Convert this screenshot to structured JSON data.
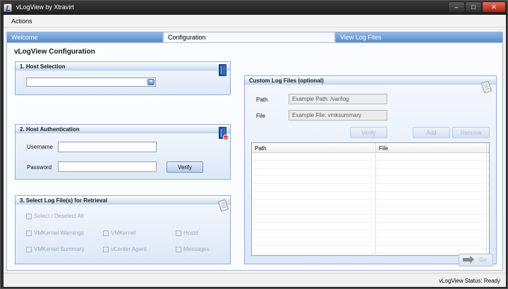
{
  "window": {
    "title": "vLogView by Xtravirt",
    "minimize": "–",
    "maximize": "□",
    "close": "✕"
  },
  "menu": {
    "items": [
      "Actions"
    ]
  },
  "tabs": [
    {
      "label": "Welcome",
      "active": false
    },
    {
      "label": "Configuration",
      "active": true
    },
    {
      "label": "View Log Files",
      "active": false
    }
  ],
  "page": {
    "title": "vLogView Configuration"
  },
  "host_selection": {
    "title": "1. Host Selection",
    "selected": "",
    "arrow": "▾"
  },
  "host_auth": {
    "title": "2. Host Authentication",
    "username_label": "Username",
    "username_value": "",
    "password_label": "Password",
    "password_value": "",
    "verify_label": "Verify"
  },
  "log_select": {
    "title": "3. Select Log File(s) for Retrieval",
    "select_all": "Select / Deselect All",
    "options": [
      "VMKernel Warnings",
      "VMKernel",
      "Hostd",
      "VMKernel Summary",
      "vCenter Agent",
      "Messages"
    ]
  },
  "custom_logs": {
    "title": "Custom Log Files (optional)",
    "path_label": "Path",
    "path_placeholder": "Example Path:  /var/log",
    "file_label": "File",
    "file_placeholder": "Example File:  vmksummary",
    "verify_label": "Verify",
    "add_label": "Add",
    "remove_label": "Remove",
    "columns": [
      "Path",
      "File"
    ]
  },
  "go": {
    "label": "Go"
  },
  "status": {
    "text": "vLogView Status: Ready"
  }
}
